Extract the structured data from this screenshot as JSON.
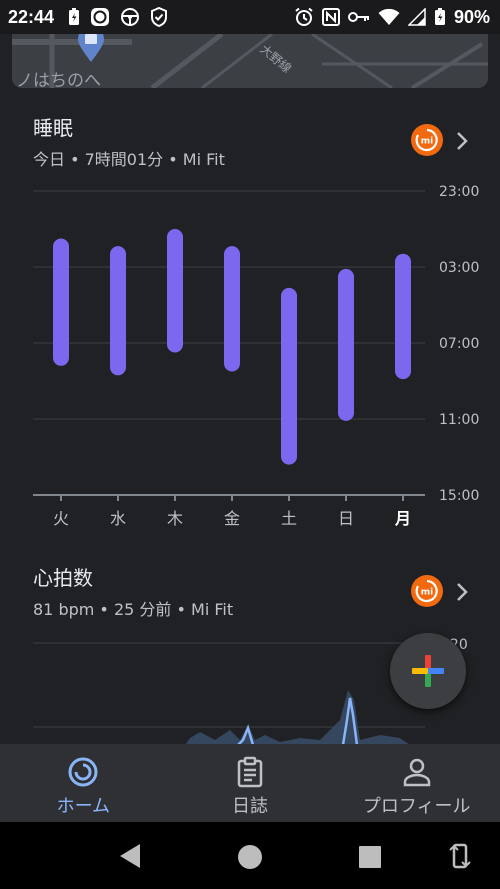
{
  "status_bar": {
    "time": "22:44",
    "battery_percent": "90%",
    "left_icons": [
      "battery-saver-icon",
      "mi-fit-icon",
      "steering-wheel-icon",
      "shield-check-icon"
    ],
    "right_icons": [
      "alarm-icon",
      "nfc-icon",
      "key-icon",
      "wifi-icon",
      "signal-icon",
      "battery-icon"
    ]
  },
  "map": {
    "place_label": "ノはちのへ",
    "road_label": "大野線"
  },
  "sleep_card": {
    "title": "睡眠",
    "subtitle": "今日 • 7時間01分 • Mi Fit",
    "source_badge": "mi",
    "chart_data": {
      "type": "bar",
      "subtype": "floating-range",
      "categories": [
        "火",
        "水",
        "木",
        "金",
        "土",
        "日",
        "月"
      ],
      "y_axis_ticks": [
        "23:00",
        "03:00",
        "07:00",
        "11:00",
        "15:00"
      ],
      "y_axis_hours_after_2300": [
        0,
        4,
        8,
        12,
        16
      ],
      "ylim": [
        0,
        16
      ],
      "values": [
        {
          "start": 2.5,
          "end": 9.2
        },
        {
          "start": 2.9,
          "end": 9.7
        },
        {
          "start": 2.0,
          "end": 8.5
        },
        {
          "start": 2.9,
          "end": 9.5
        },
        {
          "start": 5.1,
          "end": 14.4
        },
        {
          "start": 4.1,
          "end": 12.1
        },
        {
          "start": 3.3,
          "end": 9.9
        }
      ],
      "highlighted_category": "月",
      "bar_color": "#7b68ee",
      "grid": true
    }
  },
  "heart_card": {
    "title": "心拍数",
    "subtitle": "81 bpm • 25 分前 • Mi Fit",
    "source_badge": "mi",
    "chart_data": {
      "type": "area",
      "y_axis_ticks": [
        "120"
      ],
      "line_color": "#8ab4f8"
    }
  },
  "fab": {
    "icon": "google-plus-icon"
  },
  "bottom_nav": {
    "items": [
      {
        "label": "ホーム",
        "icon": "home-ring-icon",
        "active": true
      },
      {
        "label": "日誌",
        "icon": "clipboard-icon",
        "active": false
      },
      {
        "label": "プロフィール",
        "icon": "person-icon",
        "active": false
      }
    ]
  },
  "system_nav": {
    "icons": [
      "back-icon",
      "home-icon",
      "recents-icon",
      "rotate-icon"
    ]
  },
  "colors": {
    "accent": "#8ab4f8",
    "mi_orange": "#f26a10",
    "sleep_bar": "#7b68ee",
    "background": "#202124"
  }
}
